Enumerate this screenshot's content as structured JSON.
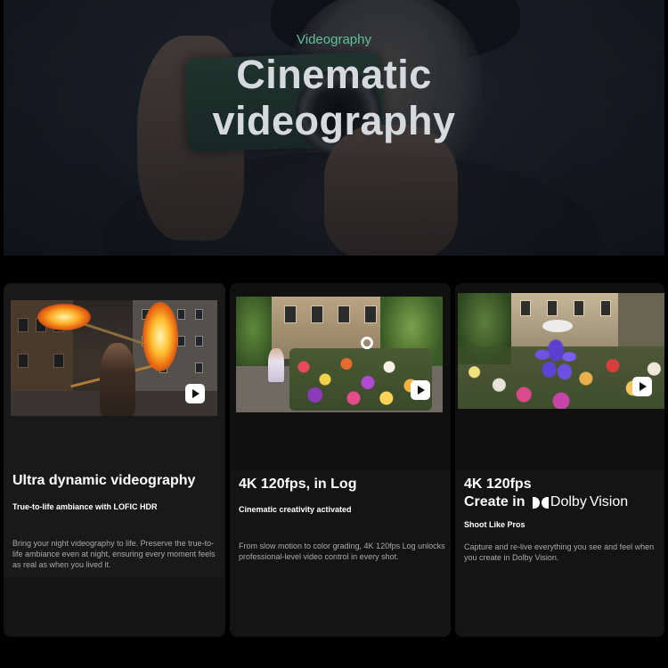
{
  "hero": {
    "eyebrow": "Videography",
    "title_line1": "Cinematic",
    "title_line2": "videography"
  },
  "cards": [
    {
      "heading": "Ultra dynamic videography",
      "subheading": "True-to-life ambiance with LOFIC HDR",
      "description": "Bring your night videography to life. Preserve the true-to-life ambiance even at night, ensuring every moment feels as real as when you lived it."
    },
    {
      "heading": "4K 120fps, in Log",
      "subheading": "Cinematic creativity activated",
      "description": "From slow motion to color grading, 4K 120fps Log unlocks professional-level video control in every shot."
    },
    {
      "heading_line1": "4K 120fps",
      "heading_line2": "Create in",
      "logo_text": "Dolby",
      "logo_suffix": "Vision",
      "subheading": "Shoot Like Pros",
      "description": "Capture and re-live everything you see and feel when you create in Dolby Vision."
    }
  ],
  "icons": {
    "play": "play-icon",
    "dolby": "dolby-double-d-icon"
  },
  "colors": {
    "eyebrow": "#5fbf9c",
    "background": "#000000",
    "card": "#141414"
  }
}
